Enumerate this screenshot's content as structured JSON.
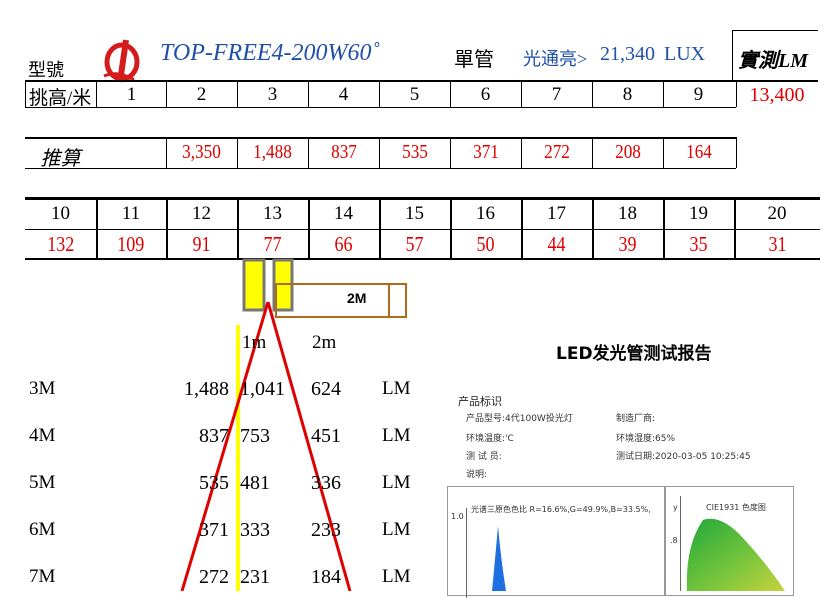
{
  "header": {
    "model_label": "型號",
    "model_name": "TOP-FREE4-200W60˚",
    "tube_label": "單管",
    "flux_label": "光通亮>",
    "lux_value": "21,340",
    "lux_unit": "LUX",
    "measured_label": "實測LM"
  },
  "row_height": {
    "label": "挑高/米",
    "values": [
      "1",
      "2",
      "3",
      "4",
      "5",
      "6",
      "7",
      "8",
      "9"
    ],
    "measured_value": "13,400"
  },
  "row_estimate": {
    "label": "推算",
    "values": [
      "",
      "3,350",
      "1,488",
      "837",
      "535",
      "371",
      "272",
      "208",
      "164"
    ]
  },
  "row_far": {
    "heights": [
      "10",
      "11",
      "12",
      "13",
      "14",
      "15",
      "16",
      "17",
      "18",
      "19",
      "20"
    ],
    "values": [
      "132",
      "109",
      "91",
      "77",
      "66",
      "57",
      "50",
      "44",
      "39",
      "35",
      "31"
    ]
  },
  "diagram": {
    "distance_label": "2M",
    "col_1m": "1m",
    "col_2m": "2m"
  },
  "lumen_table": {
    "unit": "LM",
    "rows": [
      {
        "height": "3M",
        "center": "1,488",
        "at_1m": "1,041",
        "at_2m": "624"
      },
      {
        "height": "4M",
        "center": "837",
        "at_1m": "753",
        "at_2m": "451"
      },
      {
        "height": "5M",
        "center": "535",
        "at_1m": "481",
        "at_2m": "336"
      },
      {
        "height": "6M",
        "center": "371",
        "at_1m": "333",
        "at_2m": "233"
      },
      {
        "height": "7M",
        "center": "272",
        "at_1m": "231",
        "at_2m": "184"
      }
    ]
  },
  "report": {
    "title": "LED发光管测试报告",
    "section_label": "产品标识",
    "model_line": "产品型号:4代100W投光灯",
    "maker_line": "制造厂商:",
    "temp_line": "环境温度:'C",
    "humidity_line": "环境湿度:65%",
    "tester_line": "测 试 员:",
    "date_line": "测试日期:2020-03-05 10:25:45",
    "note_line": "说明:",
    "spectrum_axis": "1.0",
    "spectrum_caption": "光谱三原色色比 R=16.6%,G=49.9%,B=33.5%,",
    "cie_title": "CIE1931 色度图",
    "cie_axis_y": "y",
    "cie_axis_val": ".8"
  },
  "colors": {
    "red": "#e00000",
    "blue": "#1f4fa8",
    "yellow": "#ffff00",
    "brown": "#b06a1a",
    "gray": "#777777"
  }
}
